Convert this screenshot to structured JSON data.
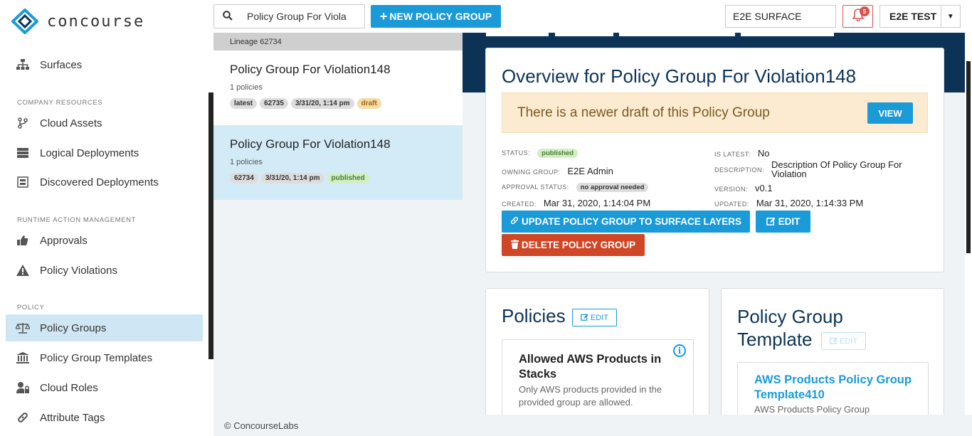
{
  "app": {
    "name": "concourse"
  },
  "sidebar": {
    "surfaces": "Surfaces",
    "section_company": "COMPANY RESOURCES",
    "cloud_assets": "Cloud Assets",
    "logical_deployments": "Logical Deployments",
    "discovered_deployments": "Discovered Deployments",
    "section_runtime": "RUNTIME ACTION MANAGEMENT",
    "approvals": "Approvals",
    "policy_violations": "Policy Violations",
    "section_policy": "POLICY",
    "policy_groups": "Policy Groups",
    "policy_group_templates": "Policy Group Templates",
    "cloud_roles": "Cloud Roles",
    "attribute_tags": "Attribute Tags"
  },
  "topbar": {
    "search_value": "Policy Group For Viola",
    "new_button": "NEW POLICY GROUP",
    "surface": "E2E SURFACE",
    "notifications": "5",
    "user": "E2E TEST"
  },
  "list": {
    "lineage": "Lineage 62734",
    "items": [
      {
        "title": "Policy Group For Violation148",
        "sub": "1 policies",
        "tag1": "latest",
        "tag2": "62735",
        "tag3": "3/31/20, 1:14 pm",
        "tag4": "draft"
      },
      {
        "title": "Policy Group For Violation148",
        "sub": "1 policies",
        "tag1": "62734",
        "tag2": "3/31/20, 1:14 pm",
        "tag3": "published"
      }
    ]
  },
  "overview": {
    "title": "Overview for Policy Group For Violation148",
    "alert": "There is a newer draft of this Policy Group",
    "view_button": "VIEW",
    "status_label": "STATUS:",
    "status_value": "published",
    "owning_label": "OWNING GROUP:",
    "owning_value": "E2E Admin",
    "approval_label": "APPROVAL STATUS:",
    "approval_value": "no approval needed",
    "created_label": "CREATED:",
    "created_value": "Mar 31, 2020, 1:14:04 PM",
    "latest_label": "IS LATEST:",
    "latest_value": "No",
    "description_label": "DESCRIPTION:",
    "description_value": "Description Of Policy Group For Violation",
    "version_label": "VERSION:",
    "version_value": "v0.1",
    "updated_label": "UPDATED:",
    "updated_value": "Mar 31, 2020, 1:14:33 PM",
    "update_button": "UPDATE POLICY GROUP TO SURFACE LAYERS",
    "edit_button": "EDIT",
    "delete_button": "DELETE POLICY GROUP"
  },
  "policies": {
    "title": "Policies",
    "edit": "EDIT",
    "card_title": "Allowed AWS Products in Stacks",
    "card_desc": "Only AWS products provided in the provided group are allowed."
  },
  "template": {
    "title": "Policy Group Template",
    "edit": "EDIT",
    "card_title": "AWS Products Policy Group Template410",
    "card_desc": "AWS Products Policy Group"
  },
  "footer": "© ConcourseLabs",
  "colors": {
    "accent": "#1a9bd8",
    "navy": "#0c3356",
    "danger": "#cf4726"
  }
}
